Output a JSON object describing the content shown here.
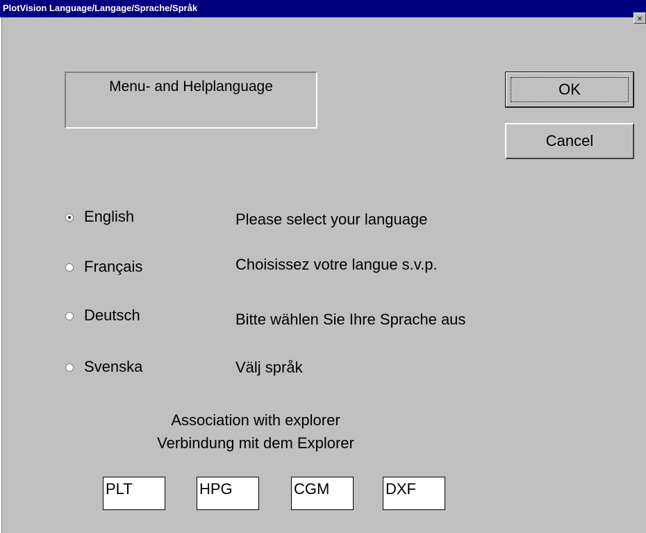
{
  "window": {
    "title": "PlotVision Language/Langage/Sprache/Språk",
    "close_glyph": "×"
  },
  "group_label": "Menu- and Helplanguage",
  "buttons": {
    "ok": "OK",
    "cancel": "Cancel"
  },
  "languages": [
    {
      "label": "English",
      "prompt": "Please select your language",
      "selected": true
    },
    {
      "label": "Français",
      "prompt": "Choisissez votre langue s.v.p.",
      "selected": false
    },
    {
      "label": "Deutsch",
      "prompt": "Bitte wählen Sie Ihre Sprache aus",
      "selected": false
    },
    {
      "label": "Svenska",
      "prompt": "Välj språk",
      "selected": false
    }
  ],
  "association": {
    "line1": "Association with explorer",
    "line2": "Verbindung mit dem Explorer"
  },
  "extensions": [
    "PLT",
    "HPG",
    "CGM",
    "DXF"
  ]
}
